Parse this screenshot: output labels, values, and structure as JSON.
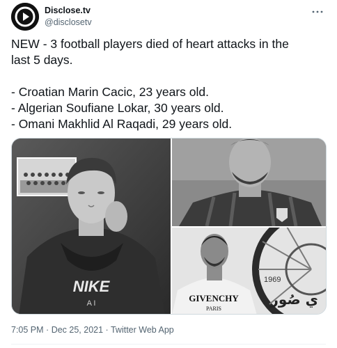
{
  "author": {
    "display_name": "Disclose.tv",
    "handle": "@disclosetv",
    "avatar_icon": "play-logo-icon"
  },
  "more_icon": "more-dots-icon",
  "tweet": {
    "lines": [
      "NEW - 3 football players died of heart attacks in the",
      "last 5 days.",
      "",
      "- Croatian Marin Cacic, 23 years old.",
      "- Algerian Soufiane Lokar, 30 years old.",
      "- Omani Makhlid Al Raqadi, 29 years old."
    ]
  },
  "media": {
    "photo_1": {
      "shirt_text": "NIKE",
      "shirt_subtext": "A I"
    },
    "photo_2": {},
    "photo_3": {
      "shirt_text": "GIVENCHY",
      "shirt_subtext": "PARIS",
      "year_text": "1969",
      "arabic_text": "ي صُور"
    }
  },
  "footer": {
    "time": "7:05 PM",
    "date": "Dec 25, 2021",
    "source": "Twitter Web App",
    "separator": "·"
  },
  "colors": {
    "text": "#0f1419",
    "muted": "#536471",
    "border": "#cfd9de"
  }
}
